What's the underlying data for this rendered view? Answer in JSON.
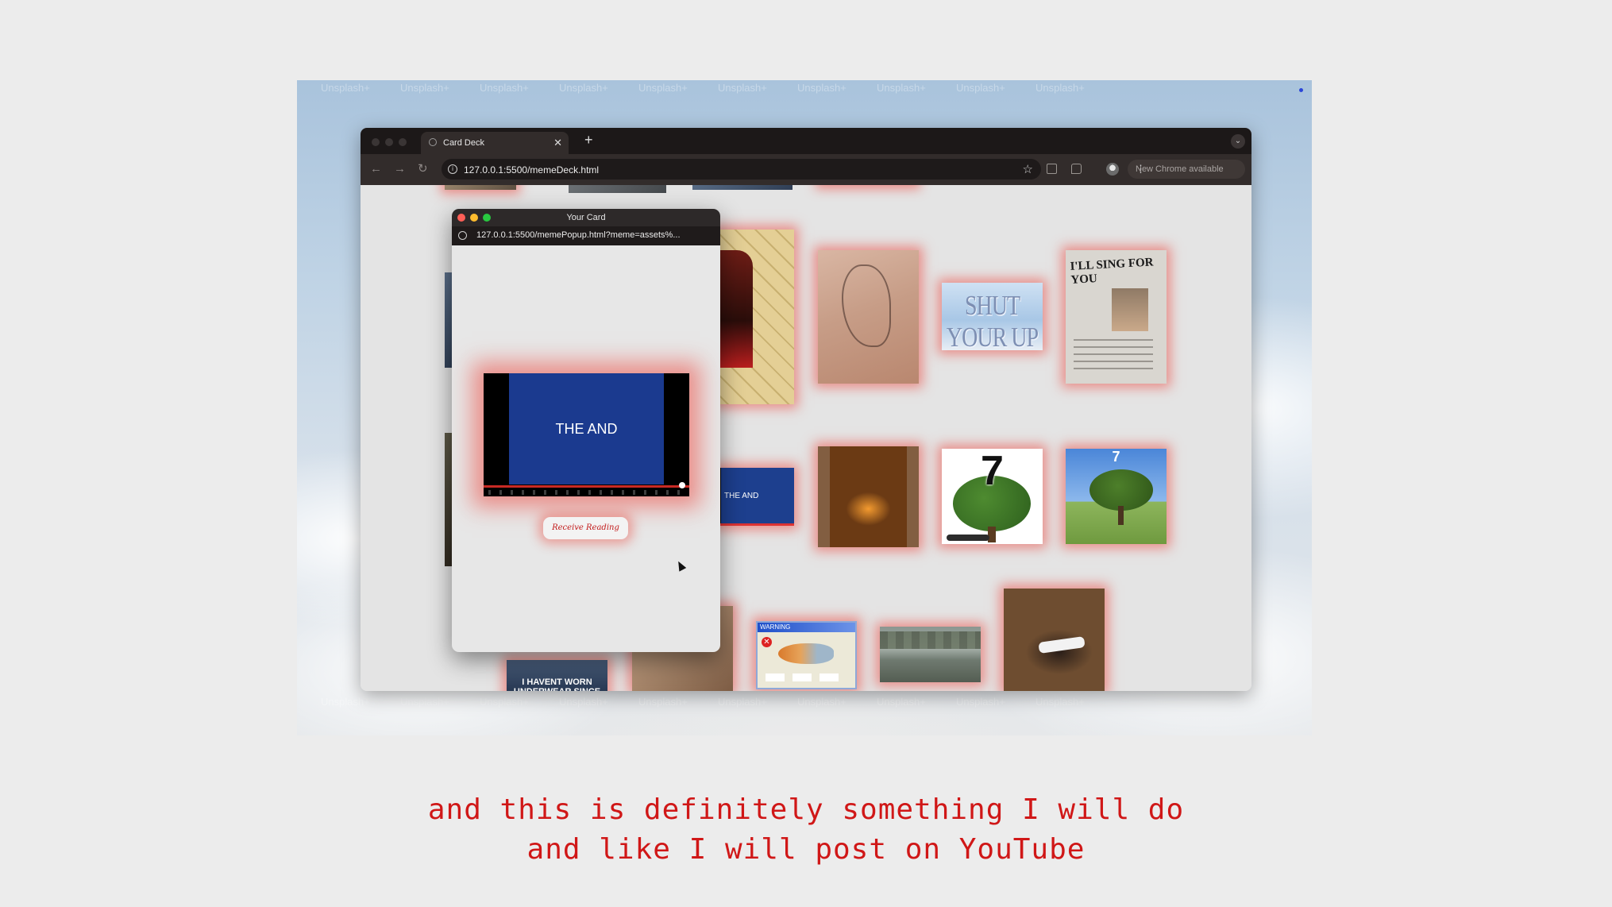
{
  "browser": {
    "tab_title": "Card Deck",
    "url": "127.0.0.1:5500/memeDeck.html",
    "update_label": "New Chrome available"
  },
  "popup": {
    "title": "Your Card",
    "url": "127.0.0.1:5500/memePopup.html?meme=assets%...",
    "video_caption": "THE AND",
    "button_label": "Receive Reading"
  },
  "cards": {
    "shut_your_up": "SHUT YOUR UP",
    "sing_for_you": "I'LL SING FOR YOU",
    "seven": "7",
    "seven_small": "7",
    "the_and_small": "THE AND",
    "warning_title": "WARNING",
    "underwear_caption": "I HAVENT WORN UNDERWEAR SINCE"
  },
  "watermark": "Unsplash+",
  "subtitle": {
    "line1": "and this is definitely something I will do",
    "line2": "and like I will post on YouTube"
  },
  "colors": {
    "subtitle": "#d01717",
    "glow": "#ec463c",
    "browser_frame": "#322c2b"
  },
  "icons": [
    "back-arrow-icon",
    "forward-arrow-icon",
    "reload-icon",
    "info-icon",
    "star-icon",
    "reading-list-icon",
    "extensions-icon",
    "profile-icon",
    "kebab-menu-icon",
    "close-icon",
    "plus-icon"
  ]
}
